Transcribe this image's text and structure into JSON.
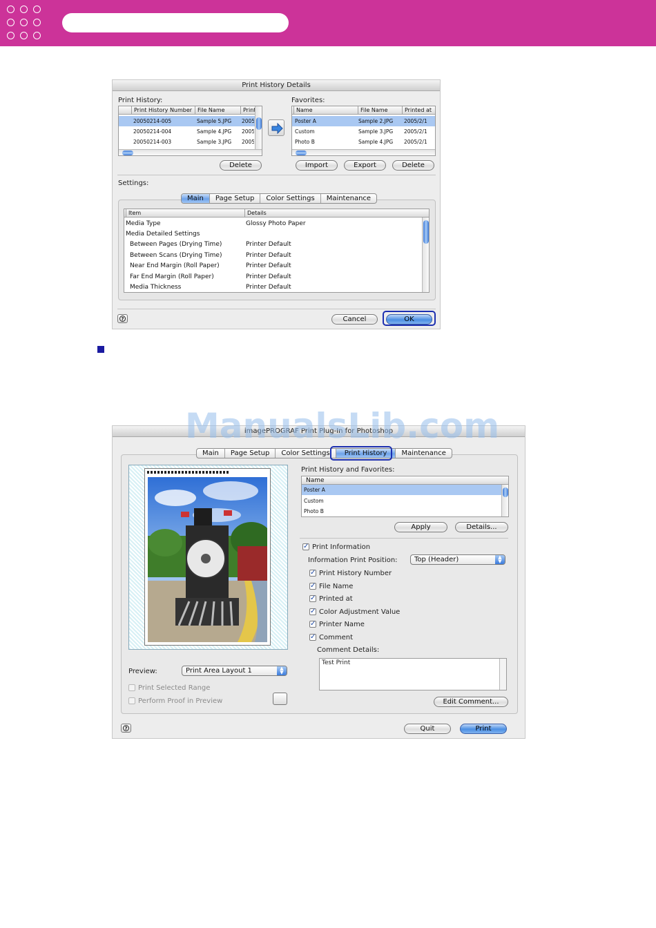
{
  "colors": {
    "accent": "#cc3399",
    "selection": "#a9c8f2",
    "button_blue": "#4c8fe3"
  },
  "dialog1": {
    "title": "Print History Details",
    "print_history": {
      "label": "Print History:",
      "columns": [
        "Print History Number",
        "File Name",
        "Printed"
      ],
      "rows": [
        {
          "number": "20050214-005",
          "file": "Sample 5.JPG",
          "printed": "2005"
        },
        {
          "number": "20050214-004",
          "file": "Sample 4.JPG",
          "printed": "2005"
        },
        {
          "number": "20050214-003",
          "file": "Sample 3.JPG",
          "printed": "2005"
        }
      ],
      "delete_label": "Delete"
    },
    "favorites": {
      "label": "Favorites:",
      "columns": [
        "Name",
        "File Name",
        "Printed at"
      ],
      "rows": [
        {
          "name": "Poster A",
          "file": "Sample 2.JPG",
          "printed": "2005/2/1"
        },
        {
          "name": "Custom",
          "file": "Sample 3.JPG",
          "printed": "2005/2/1"
        },
        {
          "name": "Photo B",
          "file": "Sample 4.JPG",
          "printed": "2005/2/1"
        }
      ],
      "import_label": "Import",
      "export_label": "Export",
      "delete_label": "Delete"
    },
    "settings": {
      "label": "Settings:",
      "tabs": [
        "Main",
        "Page Setup",
        "Color Settings",
        "Maintenance"
      ],
      "columns": [
        "Item",
        "Details"
      ],
      "rows": [
        {
          "item": "Media Type",
          "details": "Glossy Photo Paper"
        },
        {
          "item": "Media Detailed Settings",
          "details": ""
        },
        {
          "item": "Between Pages (Drying Time)",
          "details": "Printer Default"
        },
        {
          "item": "Between Scans (Drying Time)",
          "details": "Printer Default"
        },
        {
          "item": "Near End Margin (Roll Paper)",
          "details": "Printer Default"
        },
        {
          "item": "Far End Margin (Roll Paper)",
          "details": "Printer Default"
        },
        {
          "item": "Media Thickness",
          "details": "Printer Default"
        }
      ]
    },
    "cancel_label": "Cancel",
    "ok_label": "OK"
  },
  "dialog2": {
    "title": "imagePROGRAF Print Plug-In for Photoshop",
    "tabs": [
      "Main",
      "Page Setup",
      "Color Settings",
      "Print History",
      "Maintenance"
    ],
    "history_label": "Print History and Favorites:",
    "list_header": "Name",
    "list_items": [
      "Poster A",
      "Custom",
      "Photo B"
    ],
    "apply_label": "Apply",
    "details_label": "Details...",
    "print_information": "Print Information",
    "position_label": "Information Print Position:",
    "position_value": "Top (Header)",
    "checks": [
      "Print History Number",
      "File Name",
      "Printed at",
      "Color Adjustment Value",
      "Printer Name",
      "Comment"
    ],
    "comment_details_label": "Comment Details:",
    "comment_text": "Test Print",
    "edit_comment_label": "Edit Comment...",
    "preview_label": "Preview:",
    "preview_value": "Print Area Layout 1",
    "print_selected_range": "Print Selected Range",
    "perform_proof": "Perform Proof in Preview",
    "quit_label": "Quit",
    "print_label": "Print"
  },
  "watermark": "ManualsLib.com"
}
